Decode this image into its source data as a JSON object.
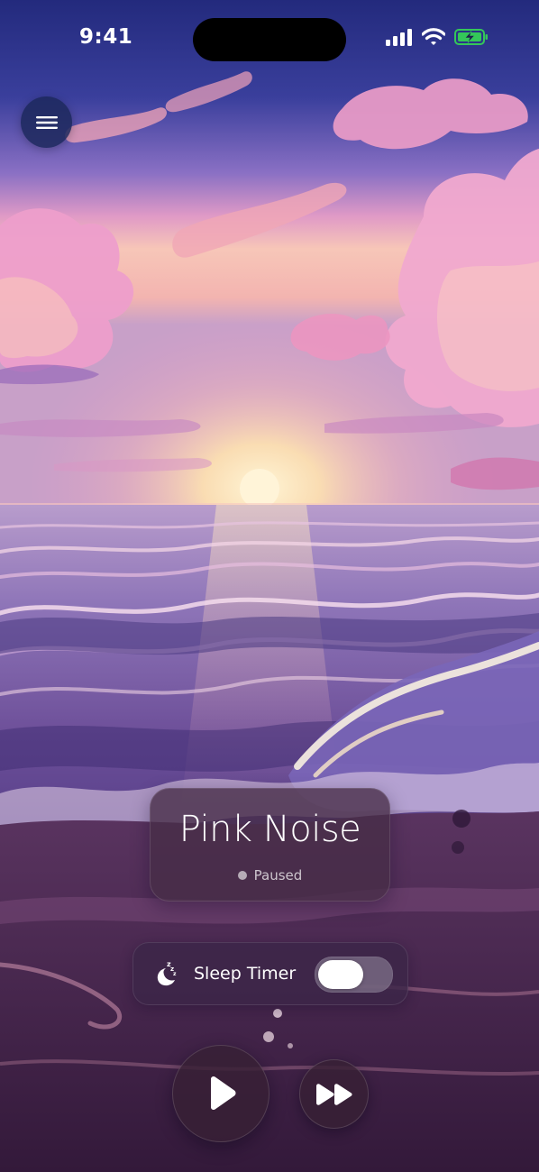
{
  "status_bar": {
    "time": "9:41",
    "icons": [
      "cellular-signal-icon",
      "wifi-icon",
      "battery-charging-icon"
    ],
    "battery_color": "#34c759"
  },
  "menu": {
    "icon": "hamburger-menu-icon"
  },
  "now_playing": {
    "title": "Pink Noise",
    "status": "Paused"
  },
  "sleep_timer": {
    "icon": "moon-zzz-icon",
    "label": "Sleep Timer",
    "enabled": false
  },
  "controls": {
    "play_icon": "play-icon",
    "forward_icon": "fast-forward-icon"
  },
  "background": {
    "scene": "sunset-ocean-illustration",
    "colors": {
      "sky_top": "#2a3287",
      "sky_pink": "#e89ac8",
      "sun_glow": "#ffe9b0",
      "sea": "#6a4f98",
      "shore": "#4a2a52"
    }
  }
}
